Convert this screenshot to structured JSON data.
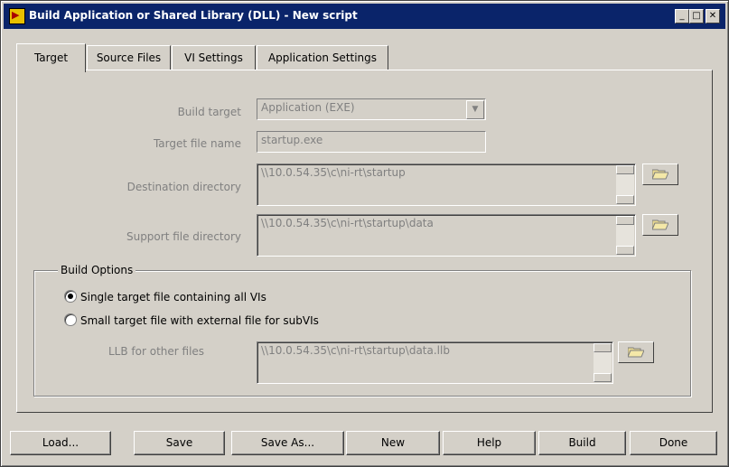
{
  "window": {
    "title": "Build Application or Shared Library (DLL) - New script",
    "minimize": "_",
    "maximize": "□",
    "close": "✕"
  },
  "tabs": [
    {
      "label": "Target",
      "active": true
    },
    {
      "label": "Source Files",
      "active": false
    },
    {
      "label": "VI Settings",
      "active": false
    },
    {
      "label": "Application Settings",
      "active": false
    }
  ],
  "target": {
    "build_target_label": "Build target",
    "build_target_value": "Application (EXE)",
    "target_file_label": "Target file name",
    "target_file_value": "startup.exe",
    "destination_label": "Destination directory",
    "destination_value": "\\\\10.0.54.35\\c\\ni-rt\\startup",
    "support_label": "Support file directory",
    "support_value": "\\\\10.0.54.35\\c\\ni-rt\\startup\\data"
  },
  "build_options": {
    "title": "Build Options",
    "option_single": "Single target file containing all VIs",
    "option_small": "Small target file with external file for subVIs",
    "selected": "single",
    "llb_label": "LLB for other files",
    "llb_value": "\\\\10.0.54.35\\c\\ni-rt\\startup\\data.llb"
  },
  "buttons": {
    "load": "Load...",
    "save": "Save",
    "save_as": "Save As...",
    "new": "New",
    "help": "Help",
    "build": "Build",
    "done": "Done"
  },
  "colors": {
    "title_bar": "#0a246a",
    "face": "#d4d0c8",
    "disabled_text": "#808080"
  }
}
